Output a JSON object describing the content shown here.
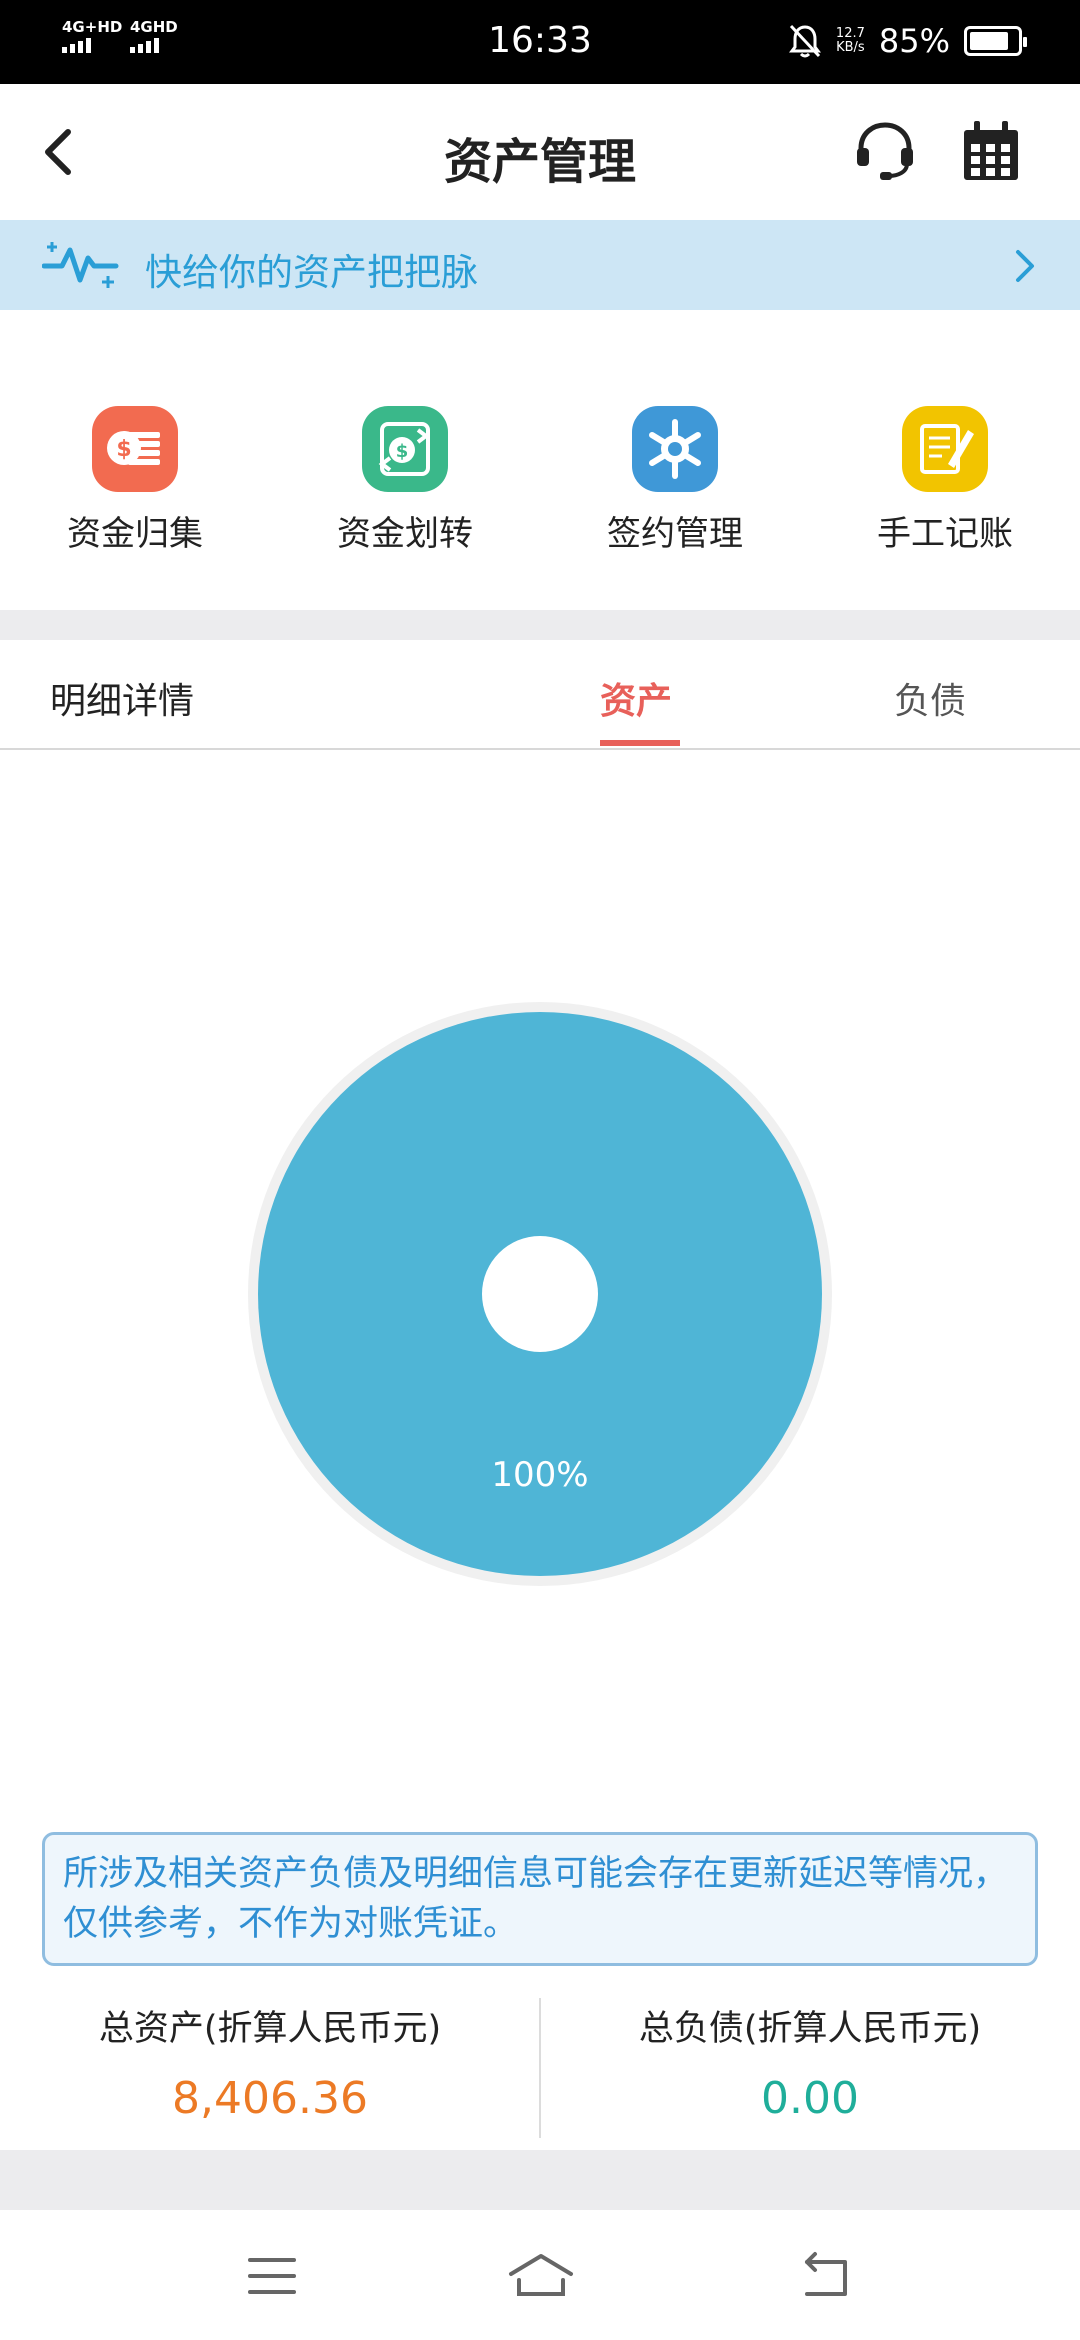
{
  "status_bar": {
    "sim1": "4G+HD",
    "sim2": "4GHD",
    "time": "16:33",
    "net_speed_value": "12.7",
    "net_speed_unit": "KB/s",
    "battery": "85%"
  },
  "header": {
    "title": "资产管理"
  },
  "banner": {
    "text": "快给你的资产把把脉"
  },
  "quick_actions": [
    {
      "label": "资金归集",
      "icon": "coins-stack-icon",
      "color": "#f26b50"
    },
    {
      "label": "资金划转",
      "icon": "transfer-icon",
      "color": "#3ab88a"
    },
    {
      "label": "签约管理",
      "icon": "sign-gear-icon",
      "color": "#3f98d7"
    },
    {
      "label": "手工记账",
      "icon": "note-pen-icon",
      "color": "#f2c400"
    }
  ],
  "tabs": {
    "detail": "明细详情",
    "assets": "资产",
    "liabilities": "负债",
    "active": "资产",
    "active_color": "#e8605a"
  },
  "chart_data": {
    "type": "pie",
    "style": "donut",
    "slices": [
      {
        "value": 100,
        "color": "#4fb5d6",
        "label": "100%"
      }
    ]
  },
  "notice": {
    "text": "所涉及相关资产负债及明细信息可能会存在更新延迟等情况，仅供参考，不作为对账凭证。"
  },
  "totals": {
    "assets_label": "总资产(折算人民币元)",
    "assets_value": "8,406.36",
    "assets_color": "#ec7a25",
    "liabilities_label": "总负债(折算人民币元)",
    "liabilities_value": "0.00",
    "liabilities_color": "#1fae9a"
  },
  "nav_bar": {
    "menu": "menu-icon",
    "home": "home-icon",
    "back": "back-icon"
  }
}
